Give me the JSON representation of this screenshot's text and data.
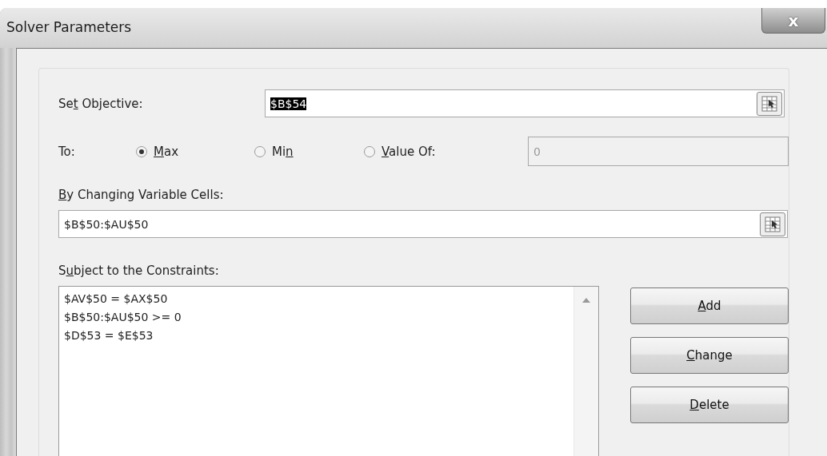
{
  "window": {
    "title": "Solver Parameters",
    "close": "x"
  },
  "objective": {
    "label": {
      "pre": "Se",
      "key": "t",
      "post": " Objective:"
    },
    "value": "$B$54",
    "selected_text": true
  },
  "to": {
    "label": "To:",
    "options": [
      {
        "label": {
          "key": "M",
          "post": "ax"
        },
        "selected": true
      },
      {
        "label": {
          "pre": "Mi",
          "key": "n"
        },
        "selected": false
      },
      {
        "label": {
          "key": "V",
          "post": "alue Of:"
        },
        "selected": false
      }
    ],
    "value_field": {
      "value": "0",
      "disabled": true
    }
  },
  "variable_cells": {
    "label": {
      "key": "B",
      "post": "y Changing Variable Cells:"
    },
    "value": "$B$50:$AU$50"
  },
  "constraints": {
    "label": {
      "pre": "S",
      "key": "u",
      "post": "bject to the Constraints:"
    },
    "items": [
      "$AV$50 = $AX$50",
      "$B$50:$AU$50 >= 0",
      "$D$53 = $E$53"
    ]
  },
  "buttons": [
    {
      "label": {
        "key": "A",
        "post": "dd"
      }
    },
    {
      "label": {
        "key": "C",
        "post": "hange"
      }
    },
    {
      "label": {
        "key": "D",
        "post": "elete"
      }
    }
  ]
}
